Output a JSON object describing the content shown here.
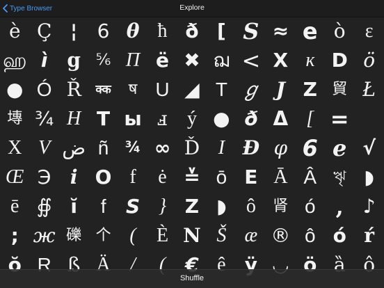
{
  "nav": {
    "back_label": "Type Browser",
    "title": "Explore"
  },
  "toolbar": {
    "shuffle_label": "Shuffle"
  },
  "glyphs": [
    [
      "è",
      "Ç",
      "¦",
      "6",
      "θ",
      "ħ",
      "ð",
      "[",
      "S",
      "≈",
      "e",
      "ò",
      "ε"
    ],
    [
      "ஹ",
      "ì",
      "g",
      "⅚",
      "Π",
      "ë",
      "✖",
      "ฌ",
      "<",
      "X",
      "ĸ",
      "D",
      "ö"
    ],
    [
      "●",
      "Ó",
      "Ř",
      "क्क",
      "ष",
      "U",
      "◢",
      "T",
      "ℊ",
      "J",
      "Z",
      "貿",
      "Ł"
    ],
    [
      "塼",
      "¾",
      "H",
      "T",
      "ы",
      "ⅎ",
      "ý",
      "●",
      "ð",
      "Δ",
      "[",
      "="
    ],
    [
      "X",
      "V",
      "ض",
      "ñ",
      "¾",
      "∞",
      "Ď",
      "I",
      "Đ",
      "φ",
      "6",
      "e",
      "√"
    ],
    [
      "Œ",
      "Э",
      "i",
      "O",
      "f",
      "ė",
      "≚",
      "ō",
      "E",
      "Ā",
      "Â",
      "ৠ",
      "◗"
    ],
    [
      "ē",
      "∯",
      "ĭ",
      "f",
      "S",
      "}",
      "Z",
      "◗",
      "ô",
      "肾",
      "ó",
      ",",
      "♪"
    ],
    [
      ";",
      "ж",
      "礫",
      "个",
      "(",
      "È",
      "N",
      "Š",
      "æ",
      "®",
      "ô",
      "ó",
      "ŕ"
    ],
    [
      "ŏ",
      "R",
      "ß",
      "Ä",
      "/",
      "(",
      "€",
      "ê",
      "ÿ",
      "◡",
      "ö",
      "ȁ",
      "ô"
    ]
  ]
}
